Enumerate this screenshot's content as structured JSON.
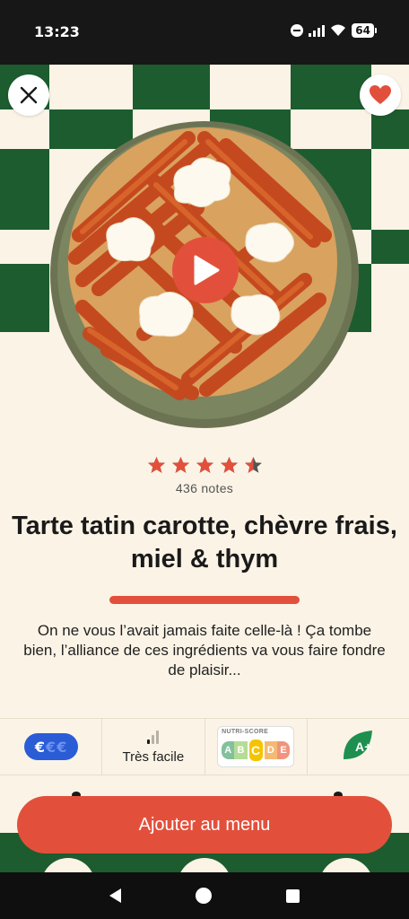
{
  "status_bar": {
    "time": "13:23",
    "battery": "64"
  },
  "hero": {
    "close_label": "close",
    "favorite_label": "favorite",
    "play_label": "play video"
  },
  "rating": {
    "stars": 4.5,
    "max": 5,
    "count_text": "436 notes"
  },
  "recipe": {
    "title": "Tarte tatin carotte, chèvre frais, miel & thym",
    "description": "On ne vous l’avait jamais faite celle-là ! Ça tombe bien, l’alliance de ces ingrédients va vous faire fondre de plaisir..."
  },
  "info": {
    "price_symbols": [
      "€",
      "€",
      "€"
    ],
    "price_level": 1,
    "difficulty_label": "Très facile",
    "difficulty_level": 1,
    "nutri_score": {
      "title": "NUTRI-SCORE",
      "letters": [
        "A",
        "B",
        "C",
        "D",
        "E"
      ],
      "selected": "C",
      "colors": [
        "#1e8f4e",
        "#7ac143",
        "#f5c400",
        "#ee8200",
        "#e63e11"
      ]
    },
    "eco_grade": "A+"
  },
  "cta": {
    "label": "Ajouter au menu"
  },
  "colors": {
    "accent": "#e2503c",
    "background": "#fbf3e6",
    "green": "#1d5c2e",
    "price_blue": "#2a5cd6"
  }
}
